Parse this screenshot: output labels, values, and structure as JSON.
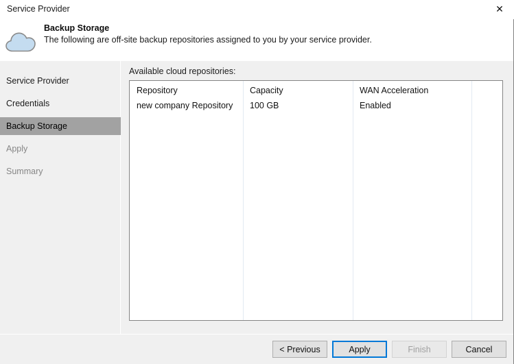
{
  "window": {
    "title": "Service Provider",
    "close_icon": "close-icon"
  },
  "header": {
    "icon": "cloud-icon",
    "title": "Backup Storage",
    "description": "The following are off-site backup repositories assigned to you by your service provider."
  },
  "sidebar": {
    "items": [
      {
        "label": "Service Provider",
        "state": "normal"
      },
      {
        "label": "Credentials",
        "state": "normal"
      },
      {
        "label": "Backup Storage",
        "state": "selected"
      },
      {
        "label": "Apply",
        "state": "disabled"
      },
      {
        "label": "Summary",
        "state": "disabled"
      }
    ]
  },
  "content": {
    "list_label": "Available cloud repositories:",
    "table": {
      "columns": [
        "Repository",
        "Capacity",
        "WAN Acceleration",
        ""
      ],
      "rows": [
        {
          "repository": "new company Repository",
          "capacity": "100 GB",
          "wan_acceleration": "Enabled",
          "extra": ""
        }
      ]
    }
  },
  "footer": {
    "buttons": [
      {
        "label": "< Previous",
        "state": "normal"
      },
      {
        "label": "Apply",
        "state": "focused"
      },
      {
        "label": "Finish",
        "state": "disabled"
      },
      {
        "label": "Cancel",
        "state": "normal"
      }
    ]
  },
  "colors": {
    "accent": "#0078d7",
    "selection": "#a2a2a2",
    "panel": "#f0f0f0",
    "cloud_fill": "#c4dcf0",
    "cloud_stroke": "#8a8a8a"
  }
}
